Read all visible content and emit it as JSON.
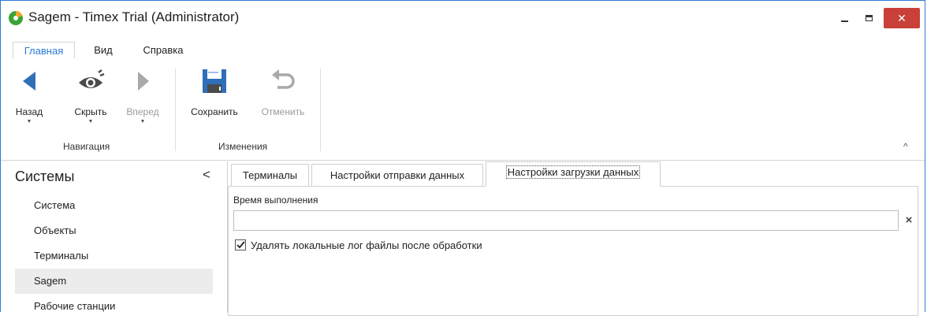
{
  "window": {
    "title": "Sagem - Timex Trial (Administrator)",
    "controls": {
      "close": "✕"
    }
  },
  "ribbon": {
    "tabs": [
      {
        "label": "Главная",
        "active": true
      },
      {
        "label": "Вид",
        "active": false
      },
      {
        "label": "Справка",
        "active": false
      }
    ],
    "buttons": {
      "back": "Назад",
      "hide": "Скрыть",
      "forward": "Вперед",
      "save": "Сохранить",
      "undo": "Отменить"
    },
    "groups": {
      "navigation": "Навигация",
      "changes": "Изменения"
    },
    "collapse_glyph": "^"
  },
  "sidebar": {
    "title": "Системы",
    "collapse_glyph": "<",
    "items": [
      {
        "label": "Система"
      },
      {
        "label": "Объекты"
      },
      {
        "label": "Терминалы"
      },
      {
        "label": "Sagem",
        "selected": true
      },
      {
        "label": "Рабочие станции"
      }
    ]
  },
  "main": {
    "tabs": [
      {
        "label": "Терминалы"
      },
      {
        "label": "Настройки отправки данных"
      },
      {
        "label": "Настройки загрузки данных",
        "active": true
      }
    ],
    "execution_time": {
      "label": "Время выполнения",
      "value": ""
    },
    "delete_logs": {
      "label": "Удалять локальные лог файлы после обработки",
      "checked": true
    }
  },
  "colors": {
    "accent": "#2b7bd3",
    "close_button": "#c84038",
    "icon_blue": "#2f6fb8",
    "icon_gray": "#4a4a4a",
    "icon_disabled": "#a9a9a9",
    "selected_row": "#ececec"
  }
}
